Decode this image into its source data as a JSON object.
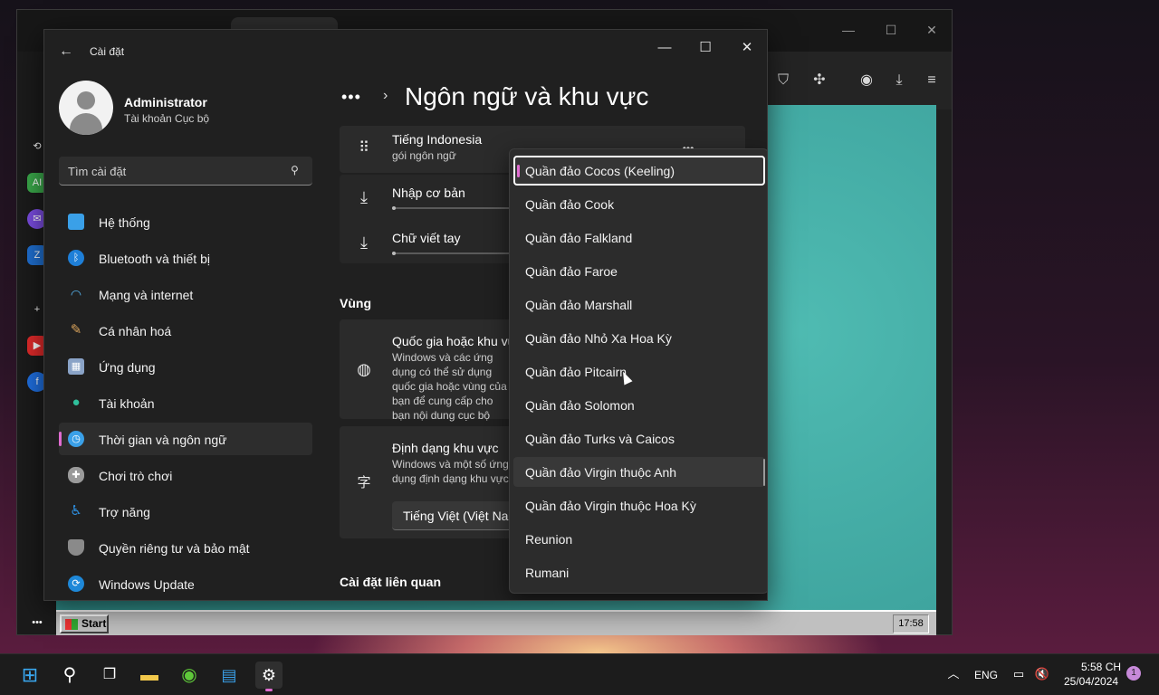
{
  "settings_window": {
    "title": "Cài đặt",
    "controls": {
      "minimize": "—",
      "maximize": "☐",
      "close": "✕"
    }
  },
  "user": {
    "name": "Administrator",
    "account_type": "Tài khoản Cục bộ"
  },
  "search": {
    "placeholder": "Tìm cài đặt"
  },
  "nav": {
    "items": [
      {
        "label": "Hệ thống",
        "icon": "monitor-icon",
        "color": "#3aa0e8"
      },
      {
        "label": "Bluetooth và thiết bị",
        "icon": "bluetooth-icon",
        "color": "#1e7fd8"
      },
      {
        "label": "Mạng và internet",
        "icon": "wifi-icon",
        "color": "#57b6f2"
      },
      {
        "label": "Cá nhân hoá",
        "icon": "brush-icon",
        "color": "#d9a35b"
      },
      {
        "label": "Ứng dụng",
        "icon": "apps-icon",
        "color": "#8aa3c7"
      },
      {
        "label": "Tài khoản",
        "icon": "person-icon",
        "color": "#2fbf9b"
      },
      {
        "label": "Thời gian và ngôn ngữ",
        "icon": "globe-clock-icon",
        "color": "#3aa0e8",
        "active": true
      },
      {
        "label": "Chơi trò chơi",
        "icon": "gamepad-icon",
        "color": "#9a9a9a"
      },
      {
        "label": "Trợ năng",
        "icon": "accessibility-icon",
        "color": "#2e8fe0"
      },
      {
        "label": "Quyền riêng tư và bảo mật",
        "icon": "shield-icon",
        "color": "#8a8a8a"
      },
      {
        "label": "Windows Update",
        "icon": "update-icon",
        "color": "#1e88d8"
      }
    ]
  },
  "content": {
    "breadcrumb_more": "•••",
    "page_title": "Ngôn ngữ và khu vực",
    "language_card": {
      "name": "Tiếng Indonesia",
      "subtitle": "gói ngôn ngữ",
      "more": "•••",
      "features": [
        {
          "label": "Nhập cơ bản",
          "progress": 0
        },
        {
          "label": "Chữ viết tay",
          "progress": 0
        }
      ]
    },
    "region_section": "Vùng",
    "country": {
      "title": "Quốc gia hoặc khu vực",
      "description": "Windows và các ứng dụng có thể sử dụng quốc gia hoặc vùng của bạn để cung cấp cho bạn nội dung cục bộ"
    },
    "regional_format": {
      "title": "Định dạng khu vực",
      "description": "Windows và một số ứng dụng định dạng khu vực của bạn",
      "selected": "Tiếng Việt (Việt Nam)"
    },
    "related_section": "Cài đặt liên quan"
  },
  "dropdown": {
    "items": [
      "Quần đảo Cocos (Keeling)",
      "Quần đảo Cook",
      "Quần đảo Falkland",
      "Quần đảo Faroe",
      "Quần đảo Marshall",
      "Quần đảo Nhỏ Xa Hoa Kỳ",
      "Quần đảo Pitcairn",
      "Quần đảo Solomon",
      "Quần đảo Turks và Caicos",
      "Quần đảo Virgin thuộc Anh",
      "Quần đảo Virgin thuộc Hoa Kỳ",
      "Reunion",
      "Rumani"
    ],
    "selected_index": 0,
    "hover_index": 9
  },
  "win98": {
    "start": "Start",
    "clock": "17:58"
  },
  "taskbar": {
    "language": "ENG",
    "time": "5:58 CH",
    "date": "25/04/2024",
    "notifications": "1"
  },
  "colors": {
    "accent": "#e06cd0",
    "window_bg": "#202020",
    "card_bg": "#2b2b2b"
  }
}
